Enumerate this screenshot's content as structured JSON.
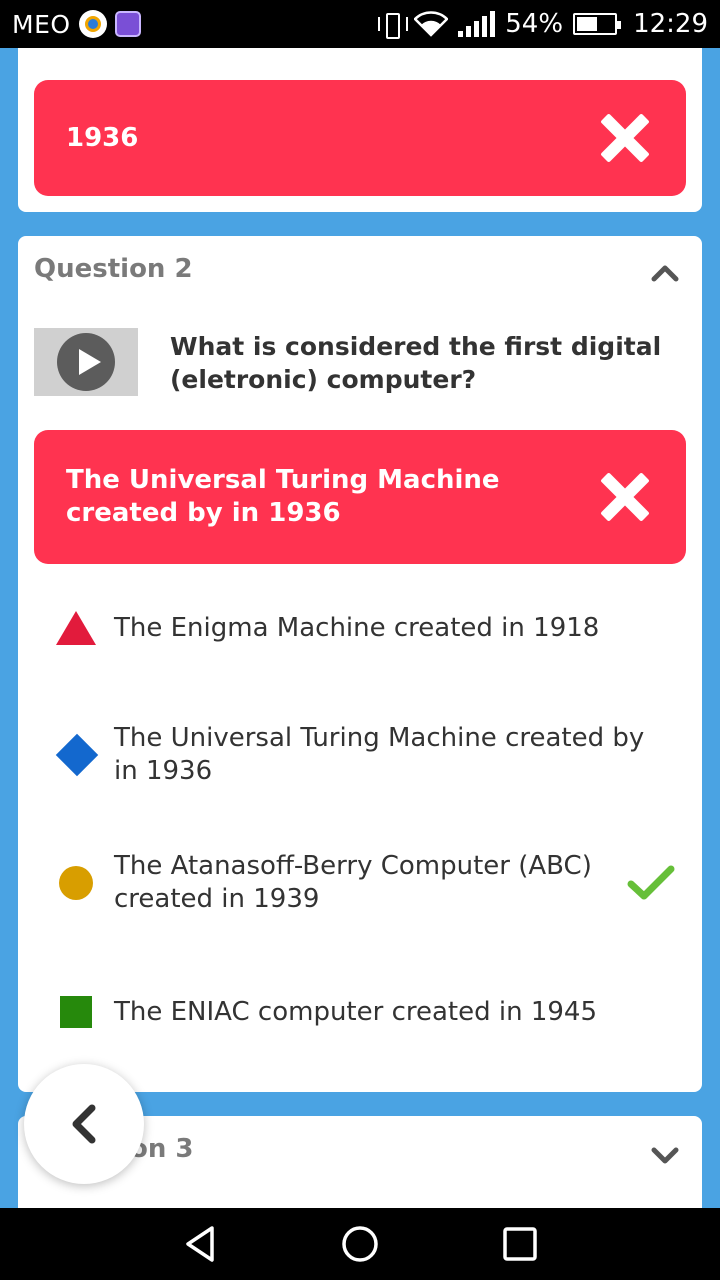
{
  "status_bar": {
    "carrier": "MEO",
    "battery": "54%",
    "time": "12:29"
  },
  "previous_answer": {
    "text": "1936"
  },
  "question2": {
    "title": "Question 2",
    "question": "What is considered the first digital (eletronic) computer?",
    "selected_answer": "The Universal Turing Machine created by in 1936",
    "options": [
      {
        "shape": "triangle",
        "color": "#e21b3c",
        "label": "The Enigma Machine created in 1918",
        "correct": false
      },
      {
        "shape": "diamond",
        "color": "#1368ce",
        "label": "The Universal Turing Machine created by in 1936",
        "correct": false
      },
      {
        "shape": "circle",
        "color": "#d89e00",
        "label": "The Atanasoff-Berry Computer (ABC) created in 1939",
        "correct": true
      },
      {
        "shape": "square",
        "color": "#26890c",
        "label": "The ENIAC computer created in 1945",
        "correct": false
      }
    ]
  },
  "question3": {
    "title_visible": "on 3"
  },
  "colors": {
    "wrong": "#ff3350",
    "correct_check": "#66bf39",
    "background": "#4aa3e3"
  },
  "icons": {
    "collapse": "chevron-up-icon",
    "expand": "chevron-down-icon",
    "back": "chevron-left-icon",
    "wrong": "close-icon",
    "correct": "check-icon",
    "media": "play-icon"
  }
}
